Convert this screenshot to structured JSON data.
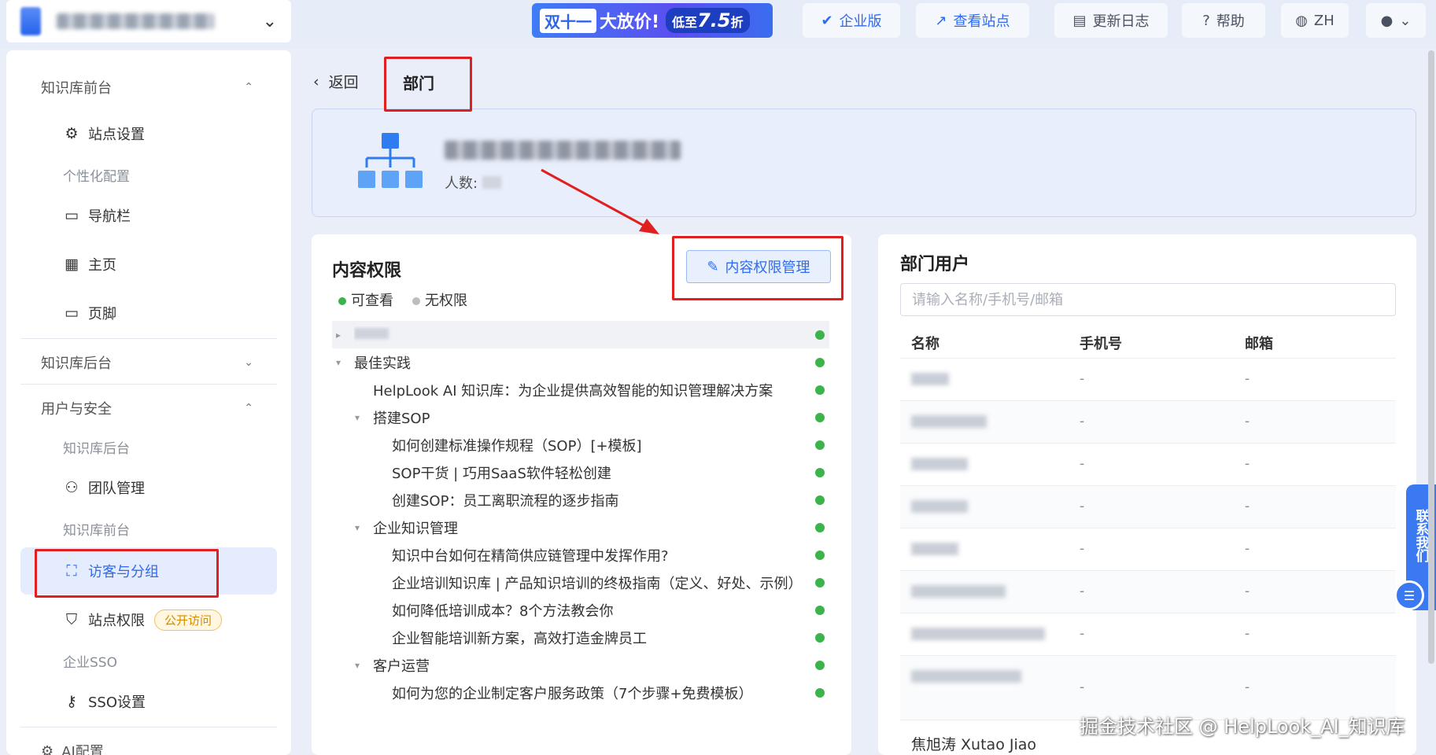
{
  "topbar": {
    "promo": {
      "part1": "双十一",
      "part2": "大放价!",
      "part3_prefix": "低至",
      "part3_num": "7.5",
      "part3_suffix": "折"
    },
    "buttons": {
      "enterprise": "企业版",
      "view_site": "查看站点",
      "changelog": "更新日志",
      "help": "帮助",
      "language": "ZH"
    }
  },
  "sidebar": {
    "group_frontend": "知识库前台",
    "site_settings": "站点设置",
    "personalize": "个性化配置",
    "navbar": "导航栏",
    "homepage": "主页",
    "footer": "页脚",
    "group_backend": "知识库后台",
    "group_user_security": "用户与安全",
    "sub_backend": "知识库后台",
    "team_manage": "团队管理",
    "sub_frontend": "知识库前台",
    "visitors_groups": "访客与分组",
    "site_permission": "站点权限",
    "public_badge": "公开访问",
    "sub_sso": "企业SSO",
    "sso_settings": "SSO设置",
    "ai_config": "AI配置"
  },
  "breadcrumb": {
    "back": "返回",
    "current": "部门"
  },
  "dept": {
    "count_label": "人数:"
  },
  "permissions": {
    "title": "内容权限",
    "legend_view": "可查看",
    "legend_none": "无权限",
    "manage_button": "内容权限管理",
    "rows": [
      "最佳实践",
      "HelpLook AI 知识库：为企业提供高效智能的知识管理解决方案",
      "搭建SOP",
      "如何创建标准操作规程（SOP）[+模板]",
      "SOP干货 | 巧用SaaS软件轻松创建",
      "创建SOP：员工离职流程的逐步指南",
      "企业知识管理",
      "知识中台如何在精简供应链管理中发挥作用?",
      "企业培训知识库 | 产品知识培训的终极指南（定义、好处、示例）",
      "如何降低培训成本？8个方法教会你",
      "企业智能培训新方案，高效打造金牌员工",
      "客户运营",
      "如何为您的企业制定客户服务政策（7个步骤+免费模板）"
    ]
  },
  "users": {
    "title": "部门用户",
    "search_placeholder": "请输入名称/手机号/邮箱",
    "col_name": "名称",
    "col_phone": "手机号",
    "col_email": "邮箱",
    "dash": "-",
    "last_user": "焦旭涛 Xutao Jiao"
  },
  "contact": "联系我们",
  "watermark": "掘金技术社区 @ HelpLook_AI_知识库",
  "colors": {
    "accent": "#2f6bf0",
    "green": "#3cb44b",
    "annotation": "#e02020"
  }
}
